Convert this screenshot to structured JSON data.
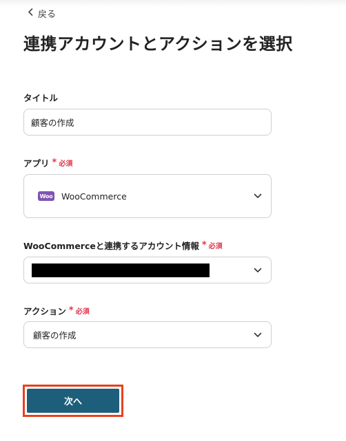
{
  "nav": {
    "back_label": "戻る"
  },
  "page": {
    "title": "連携アカウントとアクションを選択"
  },
  "form": {
    "title_field": {
      "label": "タイトル",
      "value": "顧客の作成"
    },
    "app_field": {
      "label": "アプリ",
      "required": "必須",
      "value": "WooCommerce",
      "logo_text": "Woo"
    },
    "account_field": {
      "label": "WooCommerceと連携するアカウント情報",
      "required": "必須"
    },
    "action_field": {
      "label": "アクション",
      "required": "必須",
      "value": "顧客の作成"
    }
  },
  "actions": {
    "next_label": "次へ"
  },
  "colors": {
    "primary_button": "#1d5f7a",
    "required": "#e0344b",
    "highlight_border": "#e8401a",
    "woo_brand": "#7f54b3"
  }
}
